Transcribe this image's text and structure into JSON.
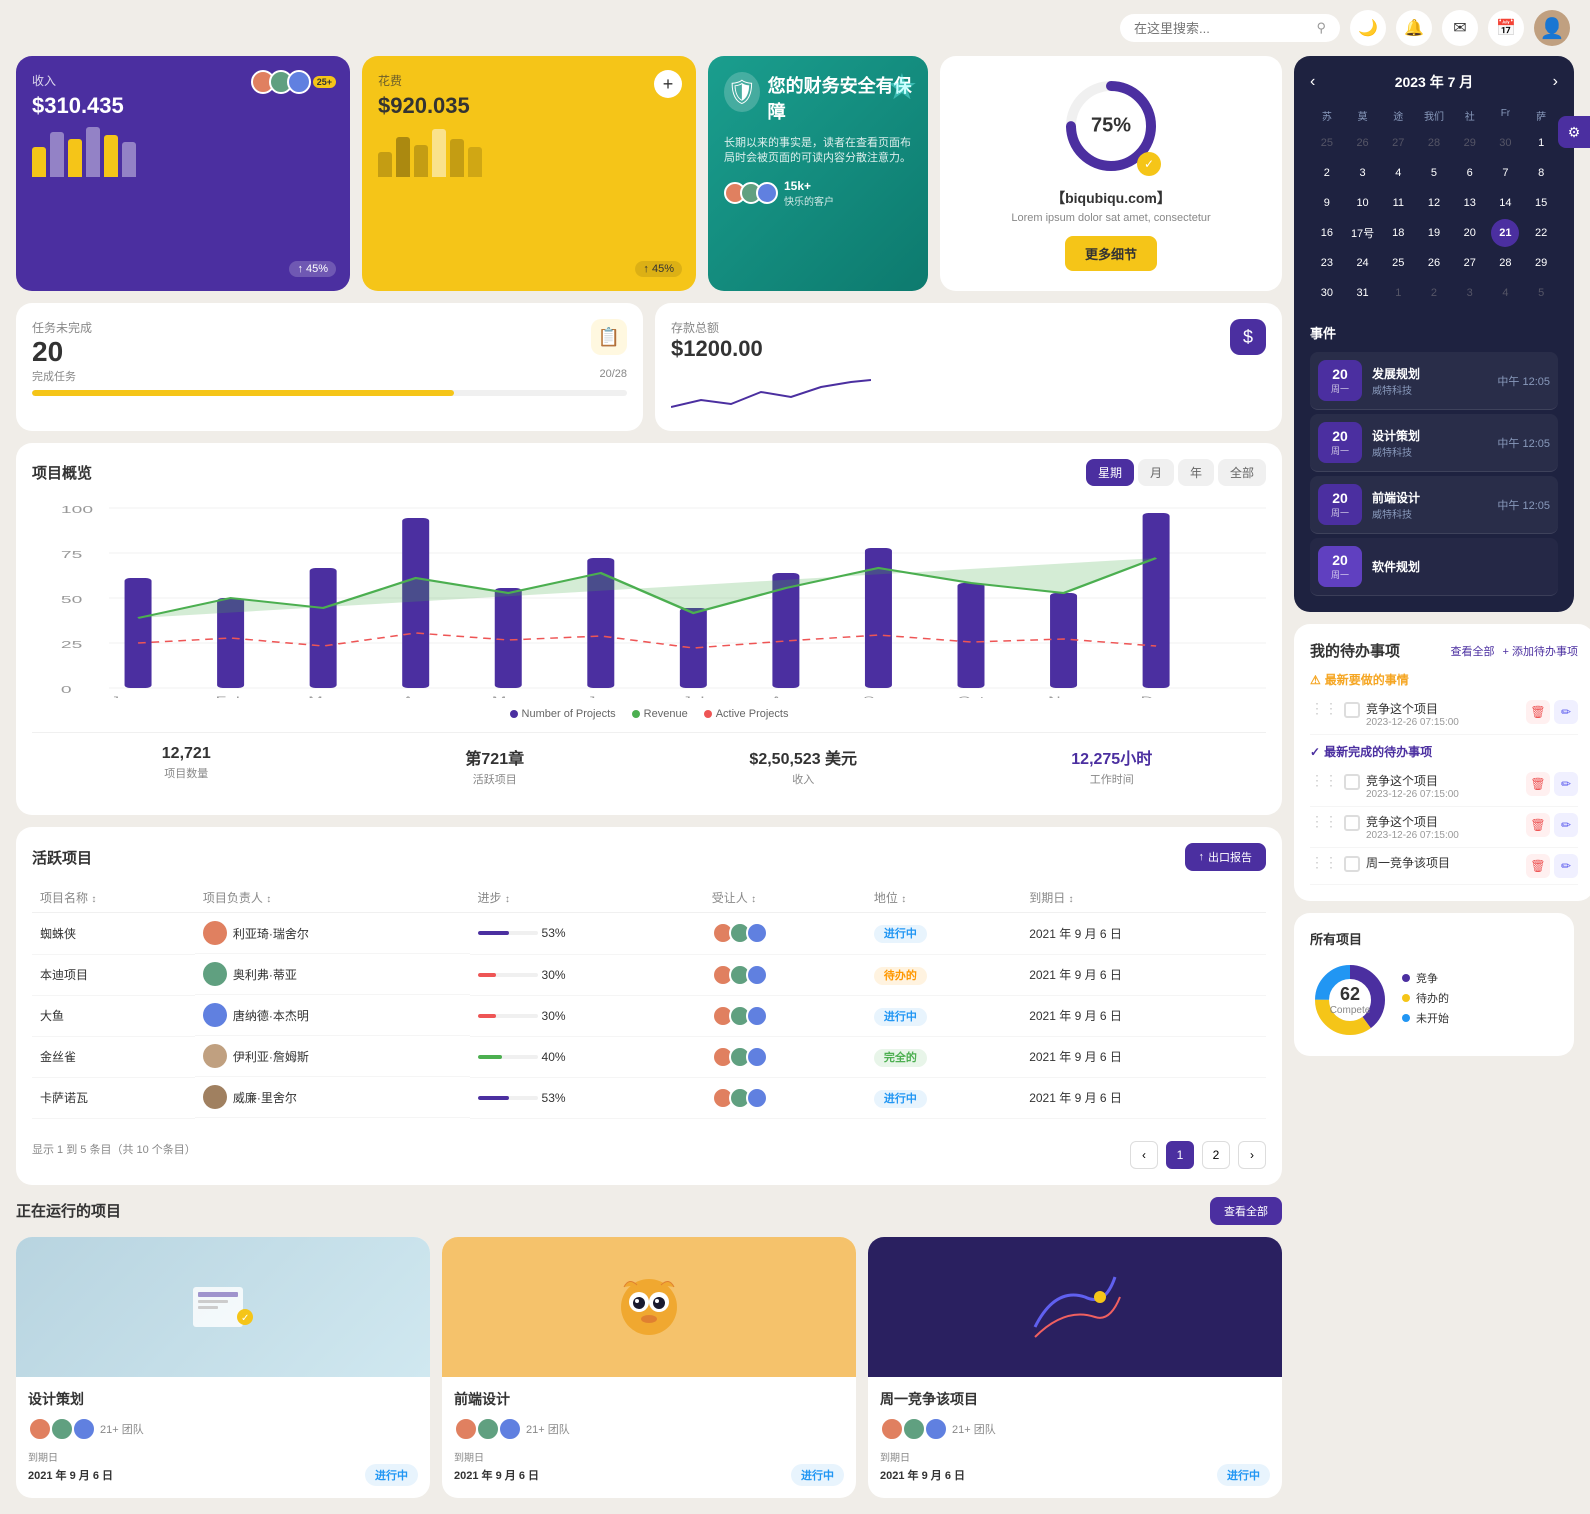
{
  "topbar": {
    "search_placeholder": "在这里搜索...",
    "dark_mode_icon": "🌙",
    "notification_icon": "🔔",
    "mail_icon": "✉",
    "calendar_icon": "📅"
  },
  "revenue": {
    "label": "收入",
    "amount": "$310.435",
    "badge": "25+",
    "percent": "45%",
    "bars": [
      30,
      50,
      40,
      65,
      55,
      45
    ]
  },
  "expense": {
    "label": "花费",
    "amount": "$920.035",
    "percent": "45%"
  },
  "security": {
    "icon": "🛡",
    "title": "您的财务安全有保障",
    "desc": "长期以来的事实是，读者在查看页面布局时会被页面的可读内容分散注意力。",
    "customers": "15k+",
    "customers_label": "快乐的客户"
  },
  "tasks": {
    "label": "任务未完成",
    "count": "20",
    "complete_label": "完成任务",
    "progress_text": "20/28",
    "progress": 71
  },
  "savings": {
    "label": "存款总额",
    "amount": "$1200.00"
  },
  "circular": {
    "percent": 75,
    "domain": "【biqubiqu.com】",
    "desc": "Lorem ipsum dolor sat amet, consectetur",
    "btn_label": "更多细节"
  },
  "project_overview": {
    "title": "项目概览",
    "tabs": [
      "星期",
      "月",
      "年",
      "全部"
    ],
    "active_tab": 0,
    "x_labels": [
      "Jan",
      "Feb",
      "Mar",
      "Apr",
      "May",
      "Jun",
      "Jul",
      "Aug",
      "Sep",
      "Oct",
      "Nov",
      "Dec"
    ],
    "y_labels": [
      "0",
      "25",
      "50",
      "75",
      "100"
    ],
    "legend": {
      "projects": "Number of Projects",
      "revenue": "Revenue",
      "active": "Active Projects"
    },
    "stats": [
      {
        "value": "12,721",
        "label": "项目数量"
      },
      {
        "value": "第721章",
        "label": "活跃项目",
        "sublabel": "活跃项目"
      },
      {
        "value": "$2,50,523 美元",
        "label": "收入"
      },
      {
        "value": "12,275小时",
        "label": "工作时间",
        "purple": true
      }
    ]
  },
  "todo": {
    "title": "我的待办事项",
    "view_all": "查看全部",
    "add_label": "+ 添加待办事项",
    "urgent_section": "最新要做的事情",
    "done_section": "最新完成的待办事项",
    "items": [
      {
        "text": "竞争这个项目",
        "date": "2023-12-26 07:15:00",
        "section": "urgent"
      },
      {
        "text": "竞争这个项目",
        "date": "2023-12-26 07:15:00",
        "section": "done"
      },
      {
        "text": "竞争这个项目",
        "date": "2023-12-26 07:15:00",
        "section": "done"
      },
      {
        "text": "周一竞争该项目",
        "date": "",
        "section": "done"
      }
    ]
  },
  "calendar": {
    "title": "2023 年 7 月",
    "day_headers": [
      "苏",
      "莫",
      "途",
      "我们",
      "社",
      "Fr",
      "萨"
    ],
    "prev_days": [
      25,
      26,
      27,
      28,
      29,
      30,
      1
    ],
    "days": [
      2,
      3,
      4,
      5,
      6,
      7,
      8,
      9,
      10,
      11,
      12,
      13,
      14,
      15,
      16,
      "17号",
      18,
      19,
      20,
      21,
      22,
      23,
      24,
      25,
      26,
      27,
      28,
      29,
      30,
      31
    ],
    "next_days": [
      1,
      2,
      3,
      4,
      5
    ],
    "today": 21,
    "events_title": "事件",
    "events": [
      {
        "date_num": "20",
        "date_day": "周一",
        "name": "发展规划",
        "company": "威特科技",
        "time": "中午 12:05"
      },
      {
        "date_num": "20",
        "date_day": "周一",
        "name": "设计策划",
        "company": "威特科技",
        "time": "中午 12:05"
      },
      {
        "date_num": "20",
        "date_day": "周一",
        "name": "前端设计",
        "company": "威特科技",
        "time": "中午 12:05"
      },
      {
        "date_num": "20",
        "date_day": "周一",
        "name": "软件规划",
        "company": "",
        "time": ""
      }
    ]
  },
  "donut": {
    "title": "所有项目",
    "center_num": "62",
    "center_label": "Compete",
    "legend": [
      {
        "label": "竞争",
        "color": "#4b2fa0",
        "value": 40
      },
      {
        "label": "待办的",
        "color": "#f5c518",
        "value": 35
      },
      {
        "label": "未开始",
        "color": "#2196F3",
        "value": 25
      }
    ]
  },
  "active_projects": {
    "title": "活跃项目",
    "export_btn": "出口报告",
    "columns": [
      "项目名称",
      "项目负责人",
      "进步",
      "受让人",
      "地位",
      "到期日"
    ],
    "rows": [
      {
        "name": "蜘蛛侠",
        "manager": "利亚琦·瑞舍尔",
        "progress": 53,
        "prog_color": "purple",
        "status": "进行中",
        "status_class": "status-active",
        "due": "2021 年 9 月 6 日"
      },
      {
        "name": "本迪项目",
        "manager": "奥利弗·蒂亚",
        "progress": 30,
        "prog_color": "red",
        "status": "待办的",
        "status_class": "status-pending",
        "due": "2021 年 9 月 6 日"
      },
      {
        "name": "大鱼",
        "manager": "唐纳德·本杰明",
        "progress": 30,
        "prog_color": "red",
        "status": "进行中",
        "status_class": "status-active",
        "due": "2021 年 9 月 6 日"
      },
      {
        "name": "金丝雀",
        "manager": "伊利亚·詹姆斯",
        "progress": 40,
        "prog_color": "green",
        "status": "完全的",
        "status_class": "status-complete",
        "due": "2021 年 9 月 6 日"
      },
      {
        "name": "卡萨诺瓦",
        "manager": "威廉·里舍尔",
        "progress": 53,
        "prog_color": "purple",
        "status": "进行中",
        "status_class": "status-active",
        "due": "2021 年 9 月 6 日"
      }
    ],
    "pagination_info": "显示 1 到 5 条目（共 10 个条目）",
    "current_page": 1,
    "total_pages": 2
  },
  "running_projects": {
    "title": "正在运行的项目",
    "view_all": "查看全部",
    "projects": [
      {
        "name": "设计策划",
        "team_count": "21+ 团队",
        "due_label": "到期日",
        "due_date": "2021 年 9 月 6 日",
        "status": "进行中",
        "status_class": "status-active",
        "bg": "design"
      },
      {
        "name": "前端设计",
        "team_count": "21+ 团队",
        "due_label": "到期日",
        "due_date": "2021 年 9 月 6 日",
        "status": "进行中",
        "status_class": "status-active",
        "bg": "frontend"
      },
      {
        "name": "周一竞争该项目",
        "team_count": "21+ 团队",
        "due_label": "到期日",
        "due_date": "2021 年 9 月 6 日",
        "status": "进行中",
        "status_class": "status-active",
        "bg": "compete"
      }
    ]
  }
}
